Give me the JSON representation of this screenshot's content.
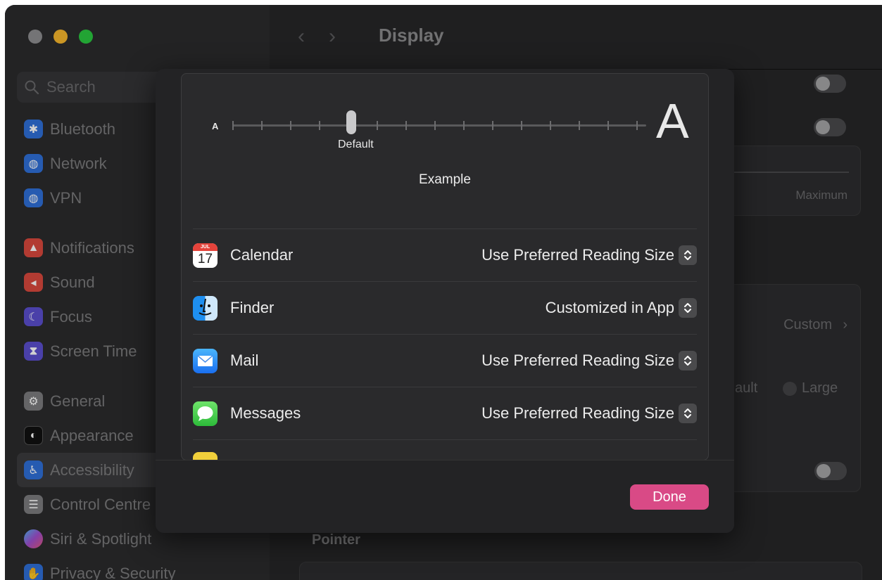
{
  "window": {
    "title": "Display"
  },
  "search": {
    "placeholder": "Search"
  },
  "sidebar": {
    "items": [
      {
        "label": "Bluetooth",
        "icon": "bluetooth-icon",
        "color": "#2f6fd8"
      },
      {
        "label": "Network",
        "icon": "globe-icon",
        "color": "#2f6fd8"
      },
      {
        "label": "VPN",
        "icon": "vpn-globe-icon",
        "color": "#2f6fd8"
      },
      {
        "label": "Notifications",
        "icon": "bell-icon",
        "color": "#d9493e"
      },
      {
        "label": "Sound",
        "icon": "speaker-icon",
        "color": "#d9493e"
      },
      {
        "label": "Focus",
        "icon": "moon-icon",
        "color": "#5b4fcf"
      },
      {
        "label": "Screen Time",
        "icon": "hourglass-icon",
        "color": "#5b4fcf"
      },
      {
        "label": "General",
        "icon": "gear-icon",
        "color": "#7c7c7e"
      },
      {
        "label": "Appearance",
        "icon": "appearance-icon",
        "color": "#1a1a1a"
      },
      {
        "label": "Accessibility",
        "icon": "accessibility-icon",
        "color": "#2f6fd8"
      },
      {
        "label": "Control Centre",
        "icon": "toggles-icon",
        "color": "#7c7c7e"
      },
      {
        "label": "Siri & Spotlight",
        "icon": "siri-icon",
        "color": "#a04fcf"
      },
      {
        "label": "Privacy & Security",
        "icon": "hand-icon",
        "color": "#2f6fd8"
      }
    ]
  },
  "background": {
    "maximum_label": "Maximum",
    "custom_label": "Custom",
    "default_partial": "ault",
    "large_label": "Large",
    "pointer_heading": "Pointer"
  },
  "sheet": {
    "slider": {
      "small_label": "A",
      "large_label": "A",
      "default_label": "Default",
      "level": 0.27
    },
    "example_label": "Example",
    "apps": [
      {
        "name": "Calendar",
        "value": "Use Preferred Reading Size",
        "icon": "calendar-icon",
        "calendar_month": "JUL",
        "calendar_day": "17"
      },
      {
        "name": "Finder",
        "value": "Customized in App",
        "icon": "finder-icon"
      },
      {
        "name": "Mail",
        "value": "Use Preferred Reading Size",
        "icon": "mail-icon"
      },
      {
        "name": "Messages",
        "value": "Use Preferred Reading Size",
        "icon": "messages-icon"
      }
    ],
    "done_label": "Done"
  },
  "colors": {
    "accent": "#d94a86"
  }
}
